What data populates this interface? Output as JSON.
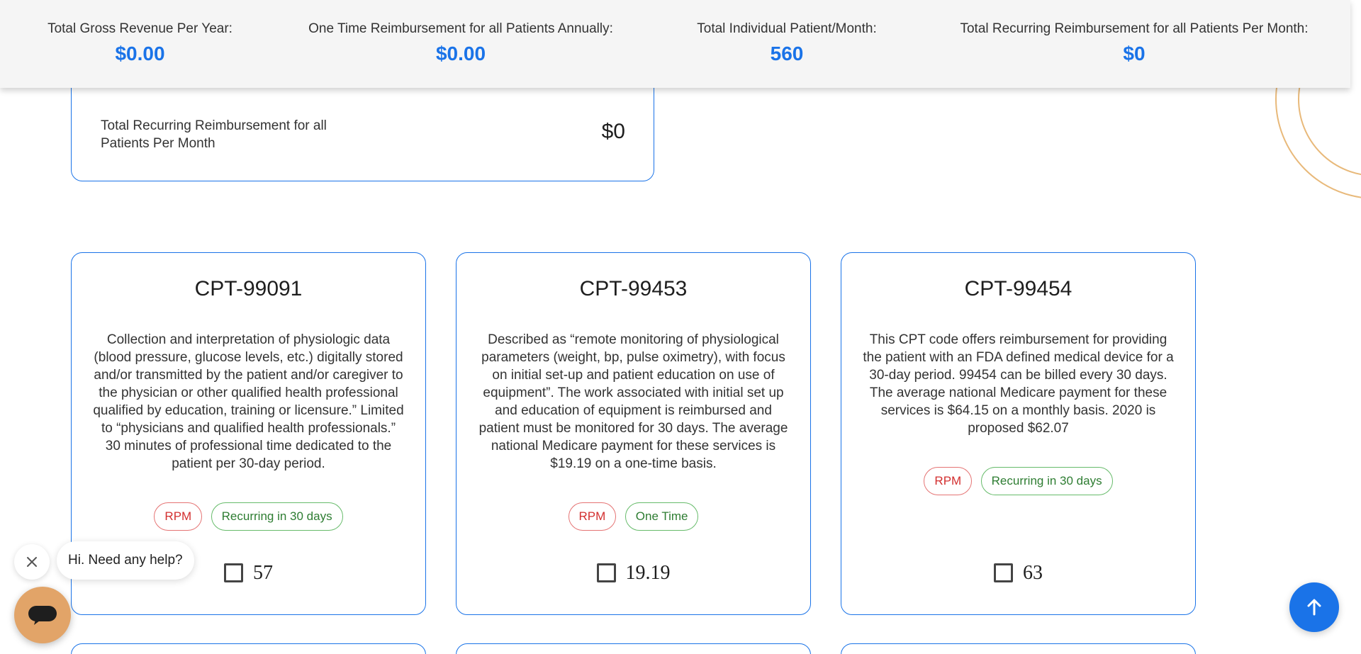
{
  "summary": {
    "items": [
      {
        "label": "Total Gross Revenue Per Year:",
        "value": "$0.00"
      },
      {
        "label": "One Time Reimbursement for all Patients Annually:",
        "value": "$0.00"
      },
      {
        "label": "Total Individual Patient/Month:",
        "value": "560"
      },
      {
        "label": "Total Recurring Reimbursement for all Patients Per Month:",
        "value": "$0"
      }
    ]
  },
  "top_card": {
    "label": "Total Recurring Reimbursement for all Patients Per Month",
    "value": "$0"
  },
  "cpt_cards": [
    {
      "title": "CPT-99091",
      "description": "Collection and interpretation of physiologic data (blood pressure, glucose levels, etc.) digitally stored and/or transmitted by the patient and/or caregiver to the physician or other qualified health professional qualified by education, training or licensure.” Limited to “physicians and qualified health professionals.” 30 minutes of professional time dedicated to the patient per 30-day period.",
      "tag_type": "RPM",
      "tag_frequency": "Recurring in 30 days",
      "amount": "57"
    },
    {
      "title": "CPT-99453",
      "description": "Described as “remote monitoring of physiological parameters (weight, bp, pulse oximetry), with focus on initial set-up and patient education on use of equipment”. The work associated with initial set up and education of equipment is reimbursed and patient must be monitored for 30 days. The average national Medicare payment for these services is $19.19 on a one-time basis.",
      "tag_type": "RPM",
      "tag_frequency": "One Time",
      "amount": "19.19"
    },
    {
      "title": "CPT-99454",
      "description": "This CPT code offers reimbursement for providing the patient with an FDA defined medical device for a 30-day period. 99454 can be billed every 30 days. The average national Medicare payment for these services is $64.15 on a monthly basis. 2020 is proposed $62.07",
      "tag_type": "RPM",
      "tag_frequency": "Recurring in 30 days",
      "amount": "63"
    }
  ],
  "chat": {
    "greeting": "Hi. Need any help?"
  },
  "icons": {
    "close": "close-icon",
    "chat": "chat-icon",
    "scroll_top": "arrow-up-icon"
  },
  "colors": {
    "accent": "#1a73e8",
    "tag_red": "#d32f2f",
    "tag_green": "#2e7d32",
    "chat_launcher": "#e2a468",
    "decor": "#e8b97a"
  }
}
